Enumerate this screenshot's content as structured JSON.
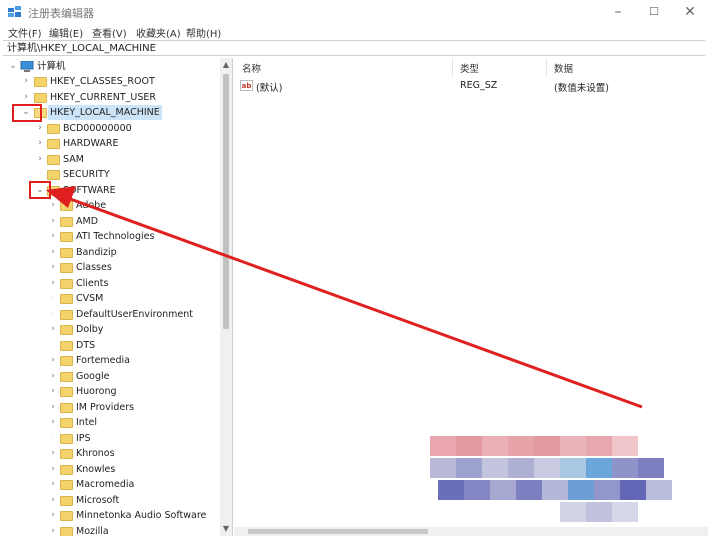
{
  "window": {
    "title": "注册表编辑器",
    "min_glyph": "–",
    "max_glyph": "☐",
    "close_glyph": "✕"
  },
  "menu": [
    "文件(F)",
    "编辑(E)",
    "查看(V)",
    "收藏夹(A)",
    "帮助(H)"
  ],
  "address": "计算机\\HKEY_LOCAL_MACHINE",
  "tree": {
    "root": "计算机",
    "top_keys": [
      "HKEY_CLASSES_ROOT",
      "HKEY_CURRENT_USER",
      "HKEY_LOCAL_MACHINE"
    ],
    "hklm_children": [
      "BCD00000000",
      "HARDWARE",
      "SAM",
      "SECURITY",
      "SOFTWARE"
    ],
    "software_children": [
      "Adobe",
      "AMD",
      "ATI Technologies",
      "Bandizip",
      "Classes",
      "Clients",
      "CVSM",
      "DefaultUserEnvironment",
      "Dolby",
      "DTS",
      "Fortemedia",
      "Google",
      "Huorong",
      "IM Providers",
      "Intel",
      "IPS",
      "Khronos",
      "Knowles",
      "Macromedia",
      "Microsoft",
      "Minnetonka Audio Software",
      "Mozilla"
    ],
    "selected": "HKEY_LOCAL_MACHINE"
  },
  "list": {
    "columns": [
      "名称",
      "类型",
      "数据"
    ],
    "rows": [
      {
        "name": "(默认)",
        "type": "REG_SZ",
        "data": "(数值未设置)",
        "icon": "ab"
      }
    ]
  },
  "colors": {
    "annotation": "#e02020",
    "selection": "#cce4f7"
  }
}
